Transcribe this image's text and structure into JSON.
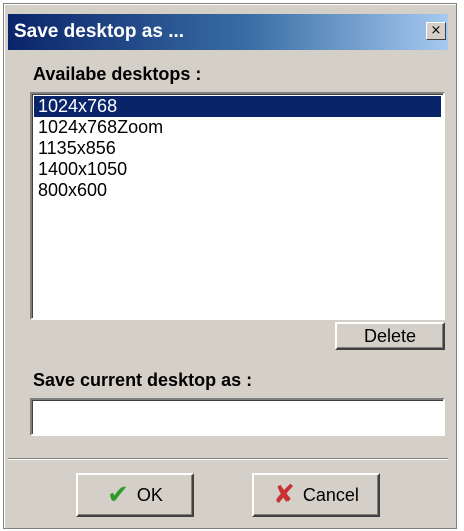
{
  "window": {
    "title": "Save desktop as ...",
    "close_symbol": "×"
  },
  "available": {
    "label": "Availabe desktops :",
    "items": [
      "1024x768",
      "1024x768Zoom",
      "1135x856",
      "1400x1050",
      "800x600"
    ],
    "selected_index": 0
  },
  "delete_button": {
    "label": "Delete"
  },
  "save_as": {
    "label": "Save current desktop as :",
    "value": "",
    "placeholder": ""
  },
  "ok_button": {
    "label": "OK",
    "icon": "checkmark-icon",
    "icon_color": "#2e9b2e"
  },
  "cancel_button": {
    "label": "Cancel",
    "icon": "x-icon",
    "icon_color": "#c83232"
  },
  "colors": {
    "dialog_bg": "#d4d0c8",
    "titlebar_start": "#0a246a",
    "titlebar_end": "#a6caf0",
    "selection": "#0a246a"
  }
}
